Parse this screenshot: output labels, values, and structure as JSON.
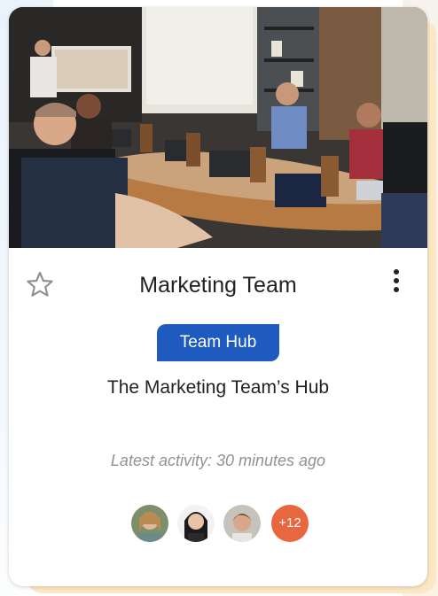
{
  "card": {
    "title": "Marketing Team",
    "badge": "Team Hub",
    "subtitle": "The Marketing Team’s Hub",
    "activity": "Latest activity: 30 minutes ago",
    "members_more": "+12"
  },
  "icons": {
    "favorite": "star-outline-icon",
    "menu": "more-vertical-icon"
  },
  "colors": {
    "badge": "#1f5bbf",
    "more_badge": "#e8673f"
  }
}
